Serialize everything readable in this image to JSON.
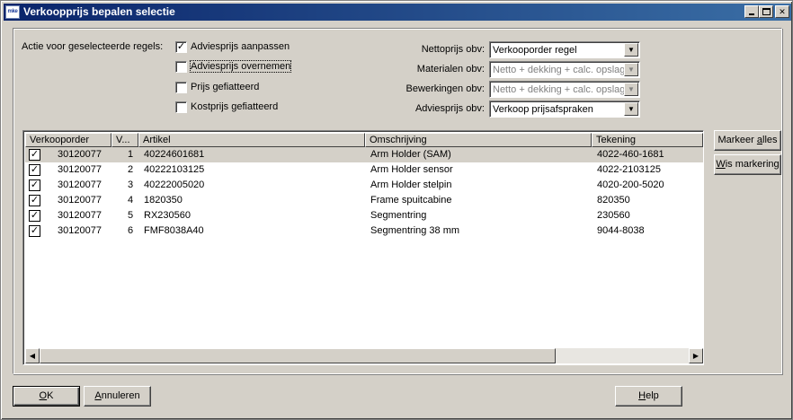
{
  "window": {
    "title": "Verkoopprijs bepalen selectie",
    "icon_text": "mke",
    "icon_name": "app-icon"
  },
  "options": {
    "actie_label": "Actie voor geselecteerde regels:",
    "checkboxes": [
      {
        "label": "Adviesprijs aanpassen",
        "checked": true
      },
      {
        "label": "Adviesprijs overnemen",
        "checked": false
      },
      {
        "label": "Prijs gefiatteerd",
        "checked": false
      },
      {
        "label": "Kostprijs gefiatteerd",
        "checked": false
      }
    ],
    "combos": [
      {
        "label": "Nettoprijs obv:",
        "value": "Verkooporder regel",
        "disabled": false
      },
      {
        "label": "Materialen obv:",
        "value": "Netto + dekking + calc. opslag",
        "disabled": true
      },
      {
        "label": "Bewerkingen obv:",
        "value": "Netto + dekking + calc. opslag",
        "disabled": true
      },
      {
        "label": "Adviesprijs obv:",
        "value": "Verkoop prijsafspraken",
        "disabled": false
      }
    ]
  },
  "grid": {
    "columns": [
      "Verkooporder",
      "V...",
      "Artikel",
      "Omschrijving",
      "Tekening"
    ],
    "rows": [
      {
        "checked": true,
        "order": "30120077",
        "v": "1",
        "artikel": "40224601681",
        "omschrijving": "Arm Holder (SAM)",
        "tekening": "4022-460-1681"
      },
      {
        "checked": true,
        "order": "30120077",
        "v": "2",
        "artikel": "40222103125",
        "omschrijving": "Arm Holder sensor",
        "tekening": "4022-2103125"
      },
      {
        "checked": true,
        "order": "30120077",
        "v": "3",
        "artikel": "40222005020",
        "omschrijving": "Arm Holder stelpin",
        "tekening": "4020-200-5020"
      },
      {
        "checked": true,
        "order": "30120077",
        "v": "4",
        "artikel": "1820350",
        "omschrijving": "Frame spuitcabine",
        "tekening": "820350"
      },
      {
        "checked": true,
        "order": "30120077",
        "v": "5",
        "artikel": "RX230560",
        "omschrijving": "Segmentring",
        "tekening": "230560"
      },
      {
        "checked": true,
        "order": "30120077",
        "v": "6",
        "artikel": "FMF8038A40",
        "omschrijving": "Segmentring 38 mm",
        "tekening": "9044-8038"
      }
    ]
  },
  "side_buttons": {
    "markeer_pre": "Markeer ",
    "markeer_u": "a",
    "markeer_post": "lles",
    "wis_u": "W",
    "wis_post": "is markering"
  },
  "footer": {
    "ok_u": "O",
    "ok_post": "K",
    "annuleren_u": "A",
    "annuleren_post": "nnuleren",
    "help_u": "H",
    "help_post": "elp"
  },
  "checkmark_glyph": "✓"
}
